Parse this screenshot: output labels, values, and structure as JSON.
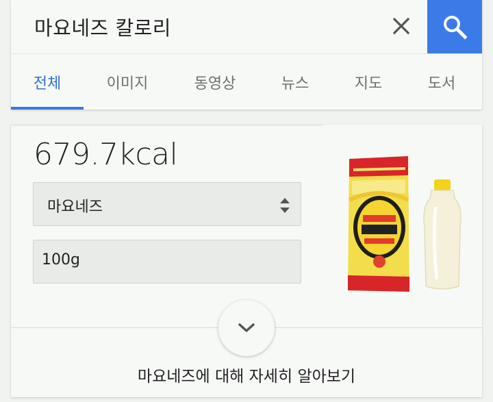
{
  "search": {
    "query": "마요네즈 칼로리"
  },
  "icons": {
    "clear": "close-icon",
    "search": "search-icon",
    "select": "updown-arrows-icon",
    "expand": "chevron-down-icon"
  },
  "tabs": [
    {
      "label": "전체",
      "active": true
    },
    {
      "label": "이미지",
      "active": false
    },
    {
      "label": "동영상",
      "active": false
    },
    {
      "label": "뉴스",
      "active": false
    },
    {
      "label": "지도",
      "active": false
    },
    {
      "label": "도서",
      "active": false
    }
  ],
  "result": {
    "calories": "679.7kcal",
    "food_selected": "마요네즈",
    "amount_value": "100g",
    "learn_more": "마요네즈에 대해 자세히 알아보기"
  },
  "colors": {
    "accent": "#3b7be8",
    "active_tab": "#3271d6",
    "background": "#f1f3f1",
    "card": "#f7f9f7"
  }
}
